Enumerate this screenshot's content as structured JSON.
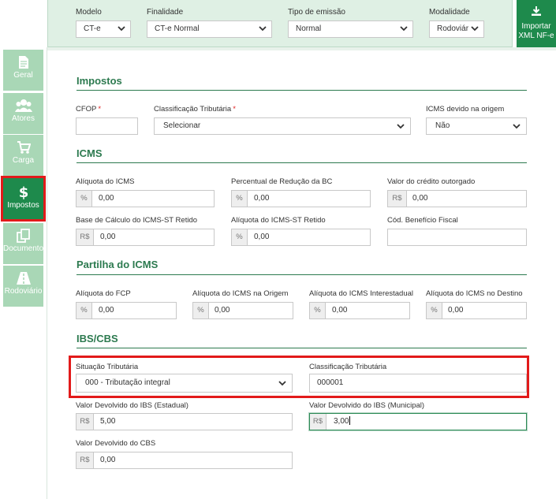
{
  "topbar": {
    "modelo": {
      "label": "Modelo",
      "value": "CT-e"
    },
    "finalidade": {
      "label": "Finalidade",
      "value": "CT-e Normal"
    },
    "tipo_emissao": {
      "label": "Tipo de emissão",
      "value": "Normal"
    },
    "modalidade": {
      "label": "Modalidade",
      "value": "Rodoviár"
    },
    "import_button": {
      "line1": "Importar",
      "line2": "XML NF-e"
    }
  },
  "sidebar": {
    "items": [
      {
        "label": "Geral",
        "icon": "document-icon"
      },
      {
        "label": "Atores",
        "icon": "users-icon"
      },
      {
        "label": "Carga",
        "icon": "cart-icon"
      },
      {
        "label": "Impostos",
        "icon": "dollar-icon",
        "active": true
      },
      {
        "label": "Documentos",
        "icon": "documents-icon"
      },
      {
        "label": "Rodoviário",
        "icon": "road-icon"
      }
    ]
  },
  "impostos": {
    "title": "Impostos",
    "cfop": {
      "label": "CFOP",
      "required": "*",
      "value": ""
    },
    "classificacao": {
      "label": "Classificação Tributária",
      "required": "*",
      "value": "Selecionar"
    },
    "icms_origem": {
      "label": "ICMS devido na origem",
      "value": "Não"
    }
  },
  "icms": {
    "title": "ICMS",
    "aliquota": {
      "label": "Alíquota do ICMS",
      "addon": "%",
      "value": "0,00"
    },
    "perc_reducao": {
      "label": "Percentual de Redução da BC",
      "addon": "%",
      "value": "0,00"
    },
    "credito_outorgado": {
      "label": "Valor do crédito outorgado",
      "addon": "R$",
      "value": "0,00"
    },
    "base_st": {
      "label": "Base de Cálculo do ICMS-ST Retido",
      "addon": "R$",
      "value": "0,00"
    },
    "aliquota_st": {
      "label": "Alíquota do ICMS-ST Retido",
      "addon": "%",
      "value": "0,00"
    },
    "cod_beneficio": {
      "label": "Cód. Benefício Fiscal",
      "value": ""
    }
  },
  "partilha": {
    "title": "Partilha do ICMS",
    "fcp": {
      "label": "Alíquota do FCP",
      "addon": "%",
      "value": "0,00"
    },
    "origem": {
      "label": "Alíquota do ICMS na Origem",
      "addon": "%",
      "value": "0,00"
    },
    "interestadual": {
      "label": "Alíquota do ICMS Interestadual",
      "addon": "%",
      "value": "0,00"
    },
    "destino": {
      "label": "Alíquota do ICMS no Destino",
      "addon": "%",
      "value": "0,00"
    }
  },
  "ibs": {
    "title": "IBS/CBS",
    "situacao": {
      "label": "Situação Tributária",
      "value": "000 - Tributação integral"
    },
    "classificacao": {
      "label": "Classificação Tributária",
      "value": "000001"
    },
    "devolvido_estadual": {
      "label": "Valor Devolvido do IBS (Estadual)",
      "addon": "R$",
      "value": "5,00"
    },
    "devolvido_municipal": {
      "label": "Valor Devolvido do IBS (Municipal)",
      "addon": "R$",
      "value": "3,00"
    },
    "devolvido_cbs": {
      "label": "Valor Devolvido do CBS",
      "addon": "R$",
      "value": "0,00"
    }
  },
  "colors": {
    "brand": "#1e8a4c",
    "sidebar": "#a9d7b6",
    "highlight": "#e21a1a",
    "section": "#2c7a4f"
  }
}
